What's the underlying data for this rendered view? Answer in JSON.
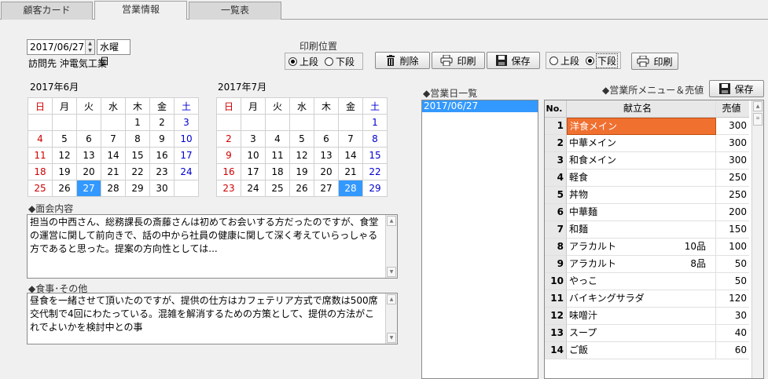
{
  "tabs": [
    {
      "label": "顧客カード"
    },
    {
      "label": "営業情報"
    },
    {
      "label": "一覧表"
    }
  ],
  "visit": {
    "date": "2017/06/27",
    "weekday": "水曜日",
    "visitor_label": "訪問先",
    "visitor_name": "沖電気工業"
  },
  "print_position": {
    "label": "印刷位置",
    "upper": "上段",
    "lower": "下段"
  },
  "toolbar": {
    "delete": "削除",
    "print": "印刷",
    "save": "保存",
    "upper": "上段",
    "lower": "下段",
    "print2": "印刷"
  },
  "cal_june": {
    "title": "2017年6月",
    "header": [
      "日",
      "月",
      "火",
      "水",
      "木",
      "金",
      "土"
    ],
    "rows": [
      [
        "",
        "",
        "",
        "",
        "1",
        "2",
        "3"
      ],
      [
        "4",
        "5",
        "6",
        "7",
        "8",
        "9",
        "10"
      ],
      [
        "11",
        "12",
        "13",
        "14",
        "15",
        "16",
        "17"
      ],
      [
        "18",
        "19",
        "20",
        "21",
        "22",
        "23",
        "24"
      ],
      [
        "25",
        "26",
        "27",
        "28",
        "29",
        "30",
        ""
      ]
    ]
  },
  "cal_july": {
    "title": "2017年7月",
    "header": [
      "日",
      "月",
      "火",
      "水",
      "木",
      "金",
      "土"
    ],
    "rows": [
      [
        "",
        "",
        "",
        "",
        "",
        "",
        "1"
      ],
      [
        "2",
        "3",
        "4",
        "5",
        "6",
        "7",
        "8"
      ],
      [
        "9",
        "10",
        "11",
        "12",
        "13",
        "14",
        "15"
      ],
      [
        "16",
        "17",
        "18",
        "19",
        "20",
        "21",
        "22"
      ],
      [
        "23",
        "24",
        "25",
        "26",
        "27",
        "28",
        "29"
      ]
    ]
  },
  "meeting": {
    "label": "◆面会内容",
    "text": "担当の中西さん、総務課長の斎藤さんは初めてお会いする方だったのですが、食堂の運営に関して前向きで、話の中から社員の健康に関して深く考えていらっしゃる方であると思った。提案の方向性としては..."
  },
  "meal": {
    "label": "◆食事･その他",
    "text": "昼食を一緒させて頂いたのですが、提供の仕方はカフェテリア方式で席数は500席交代制で4回にわたっている。混雑を解消するための方策として、提供の方法がこれでよいかを検討中との事"
  },
  "sales_days": {
    "label": "◆営業日一覧",
    "items": [
      "2017/06/27"
    ]
  },
  "menu": {
    "label": "◆営業所メニュー＆売値",
    "save": "保存",
    "col_no": "No.",
    "col_name": "献立名",
    "col_price": "売値",
    "rows": [
      {
        "no": "1",
        "name": "洋食メイン",
        "note": "",
        "price": "300"
      },
      {
        "no": "2",
        "name": "中華メイン",
        "note": "",
        "price": "300"
      },
      {
        "no": "3",
        "name": "和食メイン",
        "note": "",
        "price": "300"
      },
      {
        "no": "4",
        "name": "軽食",
        "note": "",
        "price": "250"
      },
      {
        "no": "5",
        "name": "丼物",
        "note": "",
        "price": "250"
      },
      {
        "no": "6",
        "name": "中華麺",
        "note": "",
        "price": "200"
      },
      {
        "no": "7",
        "name": "和麺",
        "note": "",
        "price": "150"
      },
      {
        "no": "8",
        "name": "アラカルト",
        "note": "10品",
        "price": "100"
      },
      {
        "no": "9",
        "name": "アラカルト",
        "note": "8品",
        "price": "50"
      },
      {
        "no": "10",
        "name": "やっこ",
        "note": "",
        "price": "50"
      },
      {
        "no": "11",
        "name": "バイキングサラダ",
        "note": "",
        "price": "120"
      },
      {
        "no": "12",
        "name": "味噌汁",
        "note": "",
        "price": "30"
      },
      {
        "no": "13",
        "name": "スープ",
        "note": "",
        "price": "40"
      },
      {
        "no": "14",
        "name": "ご飯",
        "note": "",
        "price": "60"
      }
    ]
  },
  "colors": {
    "selected": "#3399ff",
    "highlight": "#f07030",
    "sunday": "#d00000",
    "saturday": "#0000d0"
  }
}
